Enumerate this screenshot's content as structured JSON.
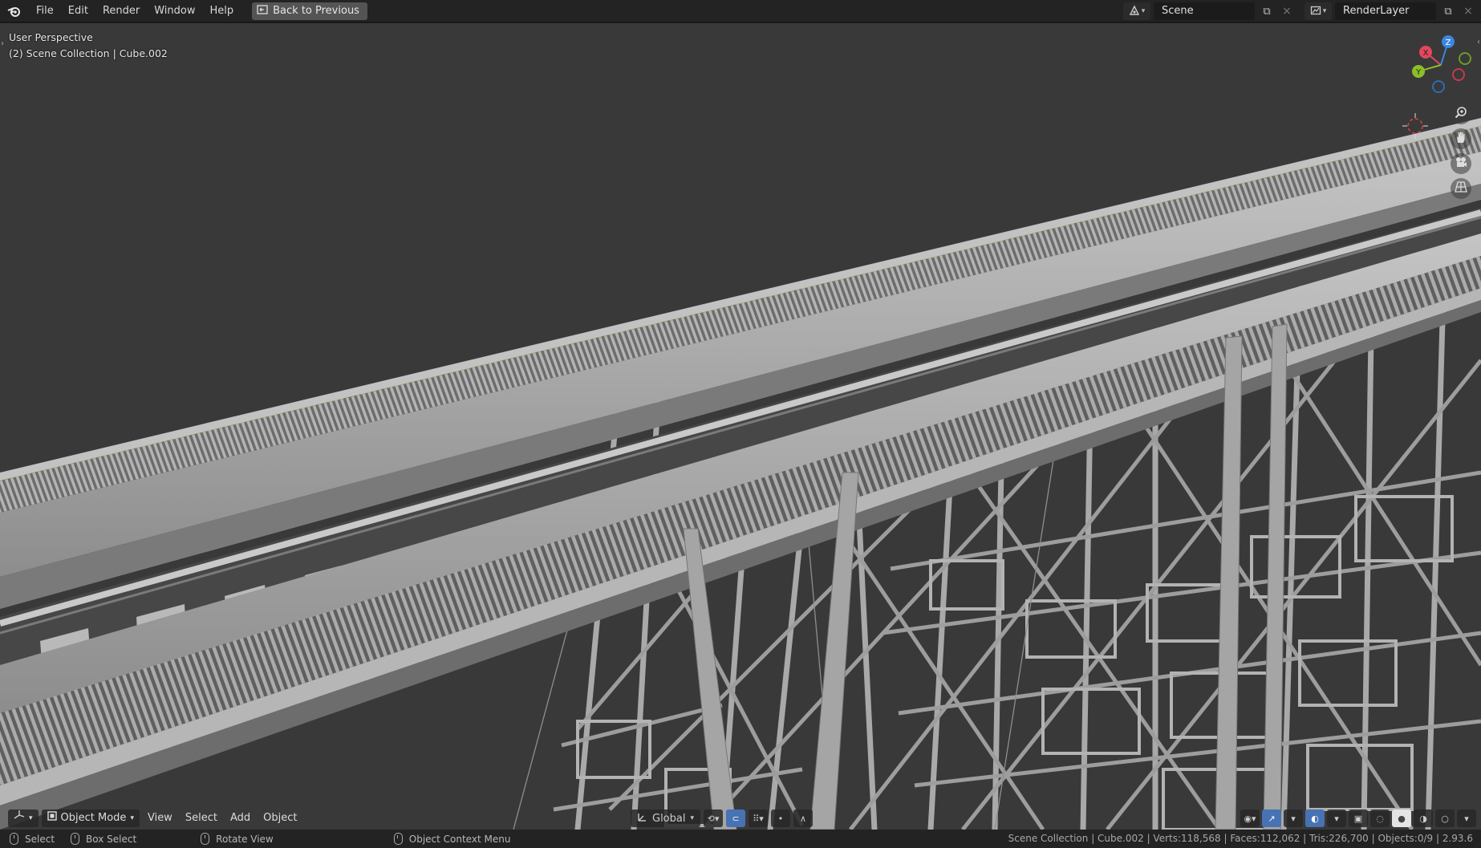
{
  "topbar": {
    "menus": [
      "File",
      "Edit",
      "Render",
      "Window",
      "Help"
    ],
    "back_button": "Back to Previous",
    "scene_field": "Scene",
    "view_layer_field": "RenderLayer"
  },
  "viewport": {
    "perspective_label": "User Perspective",
    "collection_label": "(2) Scene Collection | Cube.002",
    "gizmo_axes": {
      "x": "X",
      "y": "Y",
      "z": "Z"
    },
    "colors": {
      "background": "#393939",
      "mesh": "#a8a8a8",
      "x_axis": "#e2475e",
      "y_axis": "#8bbf29",
      "z_axis": "#3a87e0"
    }
  },
  "header": {
    "mode": "Object Mode",
    "menus": [
      "View",
      "Select",
      "Add",
      "Object"
    ],
    "transform_orientation": "Global"
  },
  "statusbar": {
    "hints": [
      {
        "label": "Select"
      },
      {
        "label": "Box Select"
      },
      {
        "label": "Rotate View"
      },
      {
        "label": "Object Context Menu"
      }
    ],
    "stats": "Scene Collection | Cube.002 | Verts:118,568 | Faces:112,062 | Tris:226,700 | Objects:0/9 | 2.93.6"
  }
}
